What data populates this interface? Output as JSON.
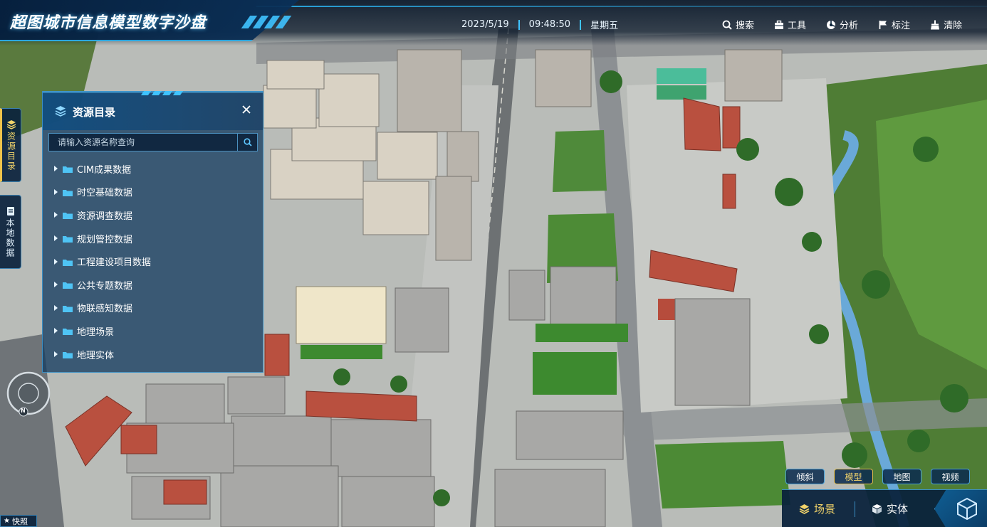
{
  "app": {
    "title": "超图城市信息模型数字沙盘"
  },
  "header": {
    "date": "2023/5/19",
    "time": "09:48:50",
    "weekday": "星期五",
    "tools": [
      {
        "label": "搜索",
        "icon": "search-icon"
      },
      {
        "label": "工具",
        "icon": "toolbox-icon"
      },
      {
        "label": "分析",
        "icon": "analysis-icon"
      },
      {
        "label": "标注",
        "icon": "flag-icon"
      },
      {
        "label": "清除",
        "icon": "broom-icon"
      }
    ]
  },
  "side_tabs": [
    {
      "label": "资源目录",
      "icon": "layers-icon",
      "active": true
    },
    {
      "label": "本地数据",
      "icon": "document-icon",
      "active": false
    }
  ],
  "resource_panel": {
    "title": "资源目录",
    "search_placeholder": "请输入资源名称查询",
    "items": [
      {
        "label": "CIM成果数据"
      },
      {
        "label": "时空基础数据"
      },
      {
        "label": "资源调查数据"
      },
      {
        "label": "规划管控数据"
      },
      {
        "label": "工程建设项目数据"
      },
      {
        "label": "公共专题数据"
      },
      {
        "label": "物联感知数据"
      },
      {
        "label": "地理场景"
      },
      {
        "label": "地理实体"
      }
    ]
  },
  "compass": {
    "north_label": "N"
  },
  "snapshot": {
    "label": "快照"
  },
  "view_modes": [
    {
      "label": "倾斜",
      "active": false
    },
    {
      "label": "模型",
      "active": true
    },
    {
      "label": "地图",
      "active": false
    },
    {
      "label": "视频",
      "active": false
    }
  ],
  "dock": {
    "scene_label": "场景",
    "entity_label": "实体"
  },
  "colors": {
    "accent": "#3fc3ff",
    "highlight": "#f3d46a",
    "panel_bg": "#163e62",
    "border": "#3b8fc4"
  }
}
